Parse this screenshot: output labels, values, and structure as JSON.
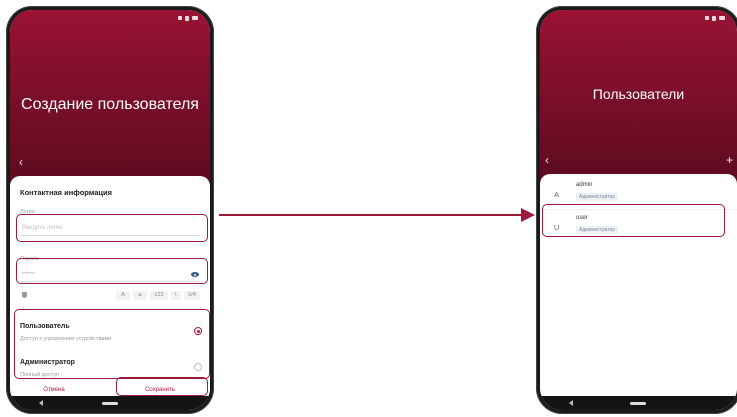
{
  "create_screen": {
    "title": "Создание пользователя",
    "section_title": "Контактная информация",
    "login_label": "Логин",
    "login_placeholder": "Введите логин",
    "password_label": "Пароль",
    "password_value": "••••••",
    "strength_chips": [
      "A",
      "a",
      "123",
      "!.",
      "0/4"
    ],
    "roles": [
      {
        "title": "Пользователь",
        "desc": "Доступ к управлению устройствами",
        "selected": true
      },
      {
        "title": "Администратор",
        "desc": "Полный доступ",
        "selected": false
      }
    ],
    "cancel_label": "Отмена",
    "save_label": "Сохранить"
  },
  "users_screen": {
    "title": "Пользователи",
    "users": [
      {
        "initial": "A",
        "name": "admin",
        "role": "Администратор"
      },
      {
        "initial": "U",
        "name": "user",
        "role": "Администратор"
      }
    ]
  },
  "icons": {
    "back": "chevron-left-icon",
    "add": "plus-icon",
    "eye": "eye-icon",
    "shield": "shield-icon"
  },
  "colors": {
    "brand": "#9a1235",
    "accent": "#b31b3c",
    "highlight": "#9b1b3a"
  }
}
